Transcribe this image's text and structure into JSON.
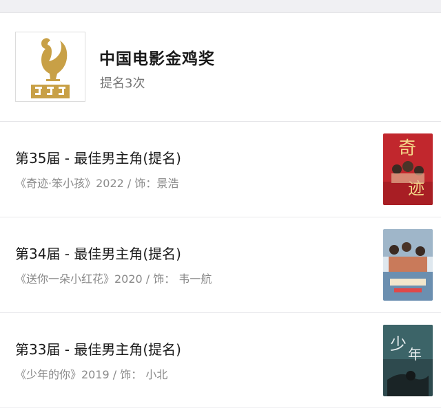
{
  "award": {
    "name": "中国电影金鸡奖",
    "count": "提名3次",
    "logo_icon": "golden-rooster-logo-icon",
    "logo_color": "#c8a046"
  },
  "nominations": [
    {
      "title": "第35届 - 最佳男主角(提名)",
      "film": "《奇迹·笨小孩》2022 / 饰：景浩",
      "poster_icon": "poster-qiji-icon",
      "poster_color": "#c1272d"
    },
    {
      "title": "第34届 - 最佳男主角(提名)",
      "film": "《送你一朵小红花》2020 / 饰： 韦一航",
      "poster_icon": "poster-xiaohonghua-icon",
      "poster_color": "#6b8fb0"
    },
    {
      "title": "第33届 - 最佳男主角(提名)",
      "film": "《少年的你》2019 / 饰： 小北",
      "poster_icon": "poster-shaonian-icon",
      "poster_color": "#2e4a4e"
    }
  ]
}
